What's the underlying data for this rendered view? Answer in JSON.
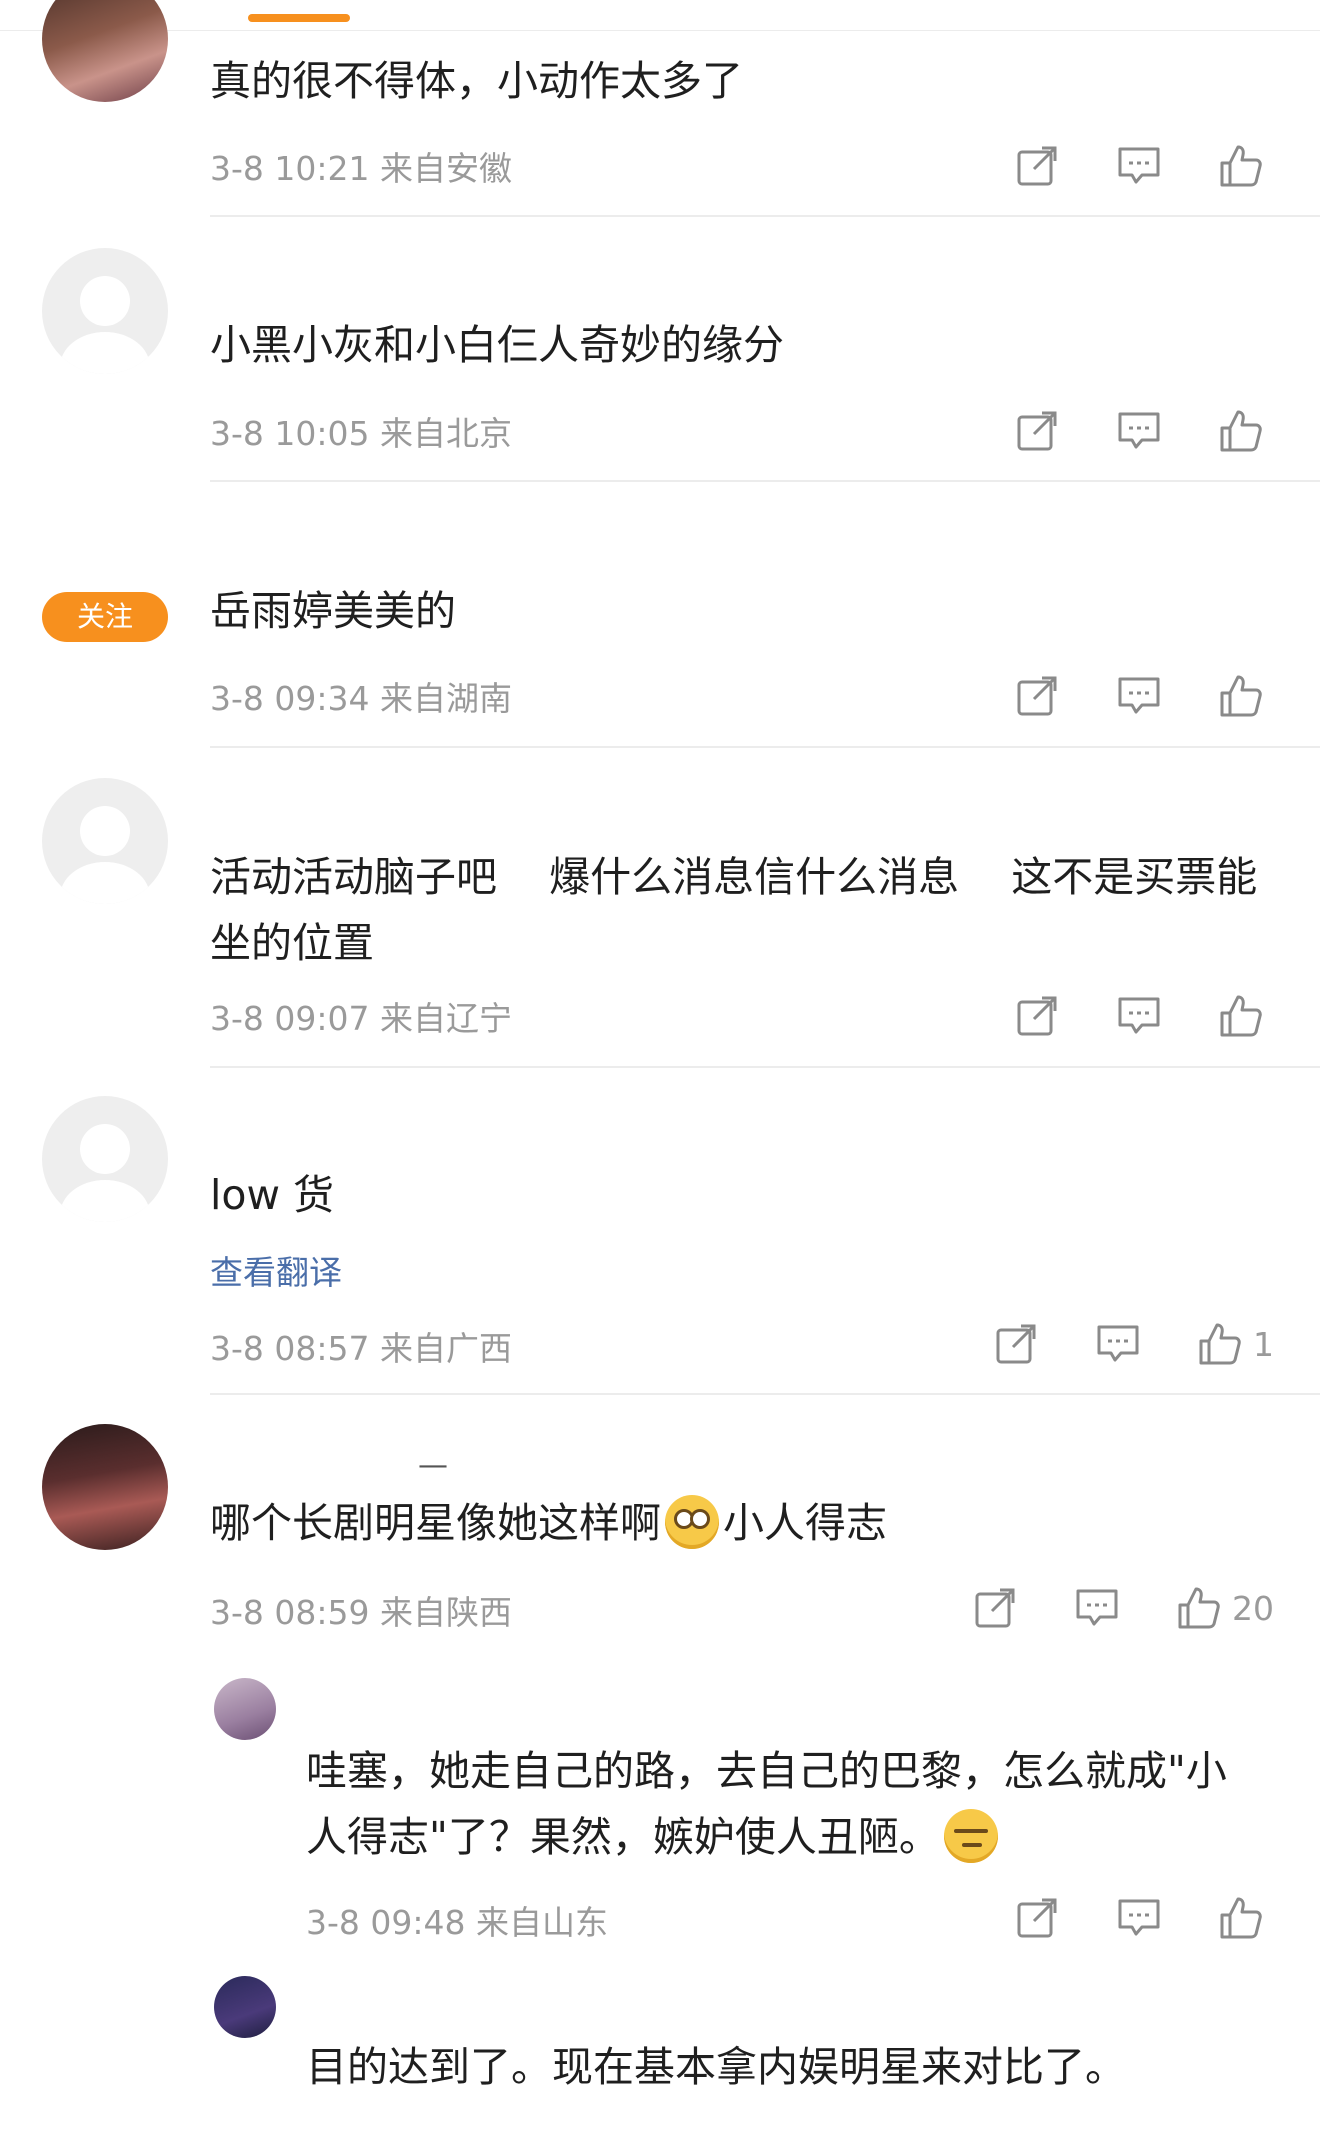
{
  "colors": {
    "accent": "#f7901e",
    "link": "#4a6ea9",
    "meta": "#9a9a9a"
  },
  "follow_label": "关注",
  "comments": [
    {
      "text": "真的很不得体，小动作太多了",
      "meta": "3-8 10:21 来自安徽",
      "likes": ""
    },
    {
      "text": "小黑小灰和小白仨人奇妙的缘分",
      "meta": "3-8 10:05 来自北京",
      "likes": ""
    },
    {
      "text": "岳雨婷美美的",
      "meta": "3-8 09:34 来自湖南",
      "likes": ""
    },
    {
      "text": "活动活动脑子吧    爆什么消息信什么消息    这不是买票能坐的位置",
      "meta": "3-8 09:07 来自辽宁",
      "likes": ""
    },
    {
      "text": "low 货",
      "translate": "查看翻译",
      "meta": "3-8 08:57 来自广西",
      "likes": "1"
    },
    {
      "text_before": "哪个长剧明星像她这样啊",
      "text_after": "小人得志",
      "meta": "3-8 08:59 来自陕西",
      "likes": "20"
    },
    {
      "text": "哇塞，她走自己的路，去自己的巴黎，怎么就成\"小人得志\"了？果然，嫉妒使人丑陋。",
      "meta": "3-8 09:48 来自山东",
      "likes": ""
    },
    {
      "text": "目的达到了。现在基本拿内娱明星来对比了。"
    }
  ],
  "icons": {
    "share": "share-icon",
    "comment": "comment-icon",
    "like": "thumbs-up-icon"
  }
}
